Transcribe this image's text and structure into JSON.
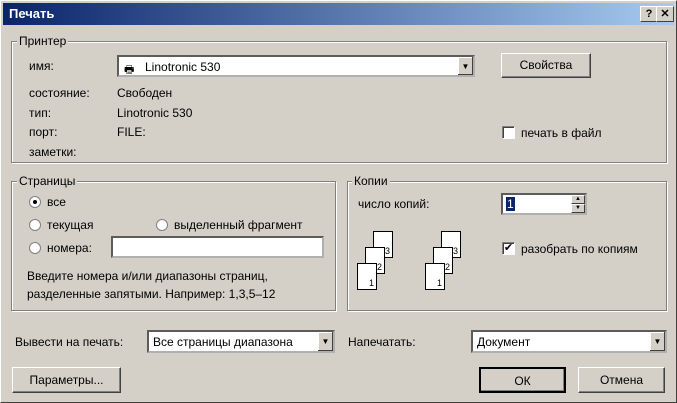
{
  "window": {
    "title": "Печать",
    "help_btn": "?",
    "close_btn": "✕"
  },
  "printer": {
    "legend": "Принтер",
    "name_label": "имя:",
    "name_value": "Linotronic 530",
    "properties_button": "Свойства",
    "status_label": "состояние:",
    "status_value": "Свободен",
    "type_label": "тип:",
    "type_value": "Linotronic 530",
    "port_label": "порт:",
    "port_value": "FILE:",
    "notes_label": "заметки:",
    "print_to_file_label": "печать в файл",
    "print_to_file_checked": false
  },
  "pages": {
    "legend": "Страницы",
    "all_label": "все",
    "current_label": "текущая",
    "selection_label": "выделенный фрагмент",
    "numbers_label": "номера:",
    "numbers_value": "",
    "selected": "all",
    "hint_line1": "Введите номера и/или диапазоны страниц,",
    "hint_line2": "разделенные запятыми. Например: 1,3,5–12"
  },
  "copies": {
    "legend": "Копии",
    "count_label": "число копий:",
    "count_value": "1",
    "collate_label": "разобрать по копиям",
    "collate_checked": true,
    "page_nums": [
      "1",
      "2",
      "3"
    ]
  },
  "print_what": {
    "label": "Вывести на печать:",
    "value": "Все страницы диапазона"
  },
  "print": {
    "label": "Напечатать:",
    "value": "Документ"
  },
  "buttons": {
    "options": "Параметры...",
    "ok": "ОК",
    "cancel": "Отмена"
  }
}
